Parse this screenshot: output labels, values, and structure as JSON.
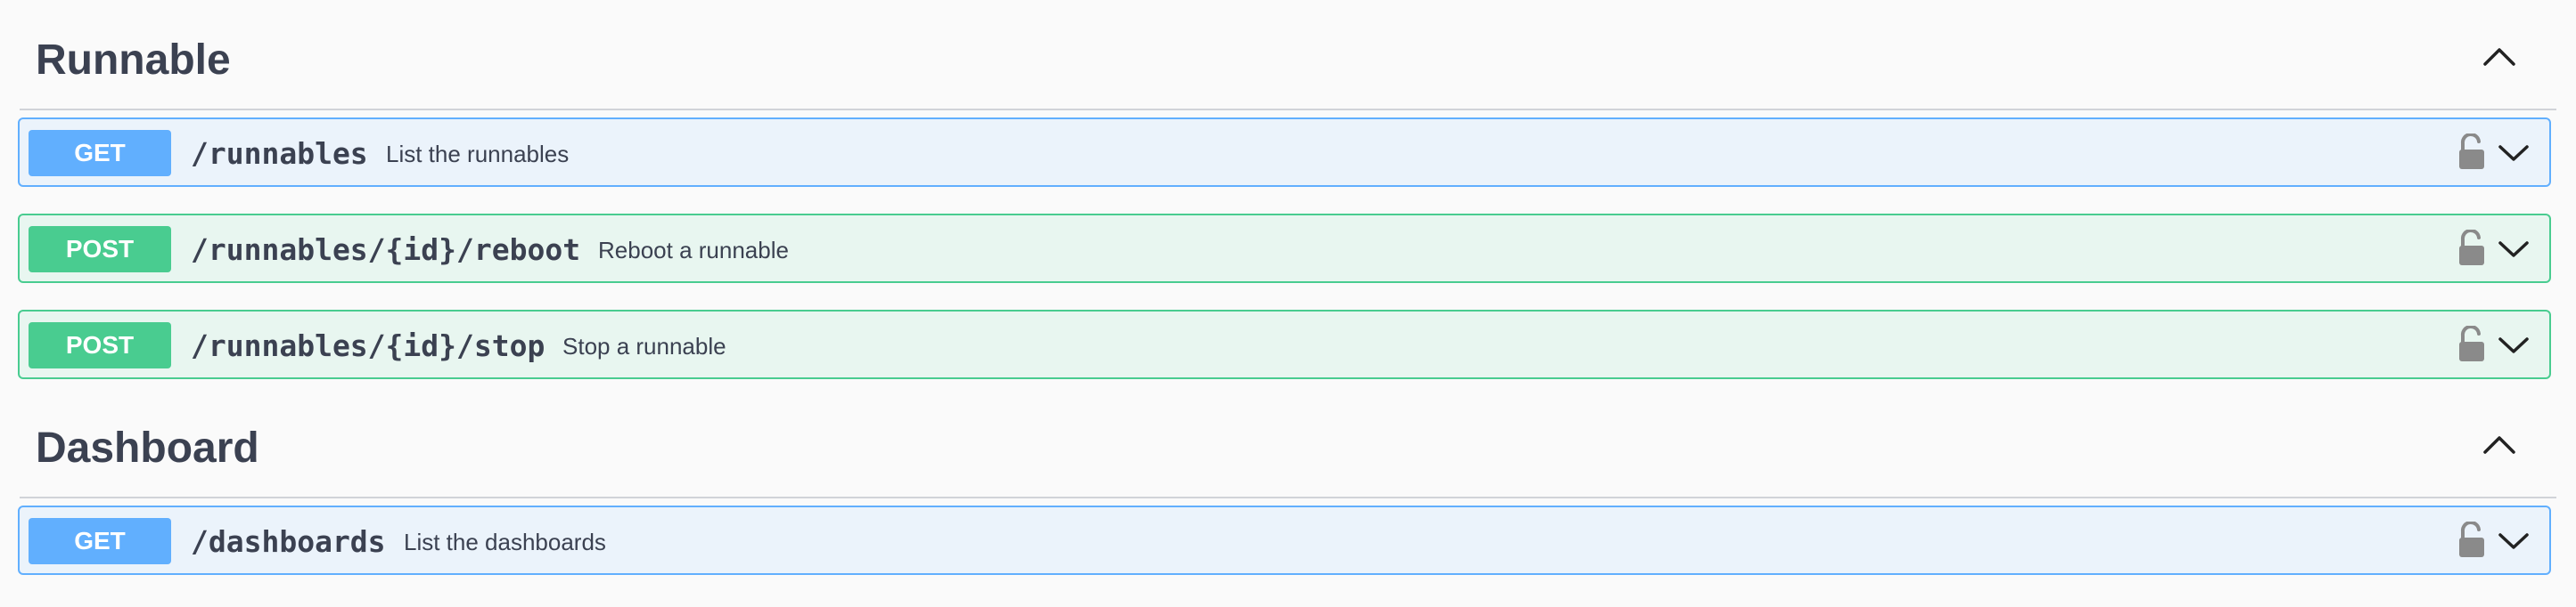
{
  "sections": [
    {
      "title": "Runnable",
      "toggle_icon": "chevron-up-icon",
      "operations": [
        {
          "method": "GET",
          "path": "/runnables",
          "summary": "List the runnables"
        },
        {
          "method": "POST",
          "path": "/runnables/{id}/reboot",
          "summary": "Reboot a runnable"
        },
        {
          "method": "POST",
          "path": "/runnables/{id}/stop",
          "summary": "Stop a runnable"
        }
      ]
    },
    {
      "title": "Dashboard",
      "toggle_icon": "chevron-up-icon",
      "operations": [
        {
          "method": "GET",
          "path": "/dashboards",
          "summary": "List the dashboards"
        }
      ]
    }
  ],
  "icons": {
    "lock": "unlocked-padlock-icon",
    "expand": "chevron-down-icon"
  },
  "colors": {
    "get": "#61affe",
    "get_bg": "#ebf3fb",
    "post": "#49cc90",
    "post_bg": "#e8f6f0",
    "text": "#3b4151"
  }
}
